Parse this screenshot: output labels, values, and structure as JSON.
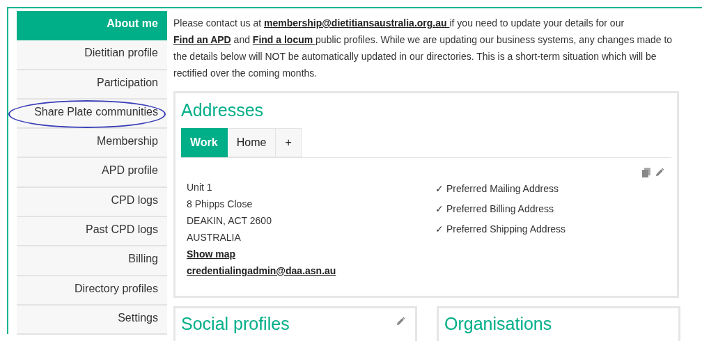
{
  "sidebar": {
    "items": [
      {
        "label": "About me",
        "selected": true,
        "circled": false
      },
      {
        "label": "Dietitian profile",
        "selected": false,
        "circled": false
      },
      {
        "label": "Participation",
        "selected": false,
        "circled": false
      },
      {
        "label": "Share Plate communities",
        "selected": false,
        "circled": true
      },
      {
        "label": "Membership",
        "selected": false,
        "circled": false
      },
      {
        "label": "APD profile",
        "selected": false,
        "circled": false
      },
      {
        "label": "CPD logs",
        "selected": false,
        "circled": false
      },
      {
        "label": "Past CPD logs",
        "selected": false,
        "circled": false
      },
      {
        "label": "Billing",
        "selected": false,
        "circled": false
      },
      {
        "label": "Directory profiles",
        "selected": false,
        "circled": false
      },
      {
        "label": "Settings",
        "selected": false,
        "circled": false
      }
    ]
  },
  "notice": [
    {
      "kind": "text",
      "text": "Please contact us at "
    },
    {
      "kind": "link",
      "text": "membership@dietitiansaustralia.org.au "
    },
    {
      "kind": "text",
      "text": "if you need to update your details for our "
    },
    {
      "kind": "link",
      "text": "Find an APD"
    },
    {
      "kind": "text",
      "text": " and "
    },
    {
      "kind": "link",
      "text": "Find a locum "
    },
    {
      "kind": "text",
      "text": "public profiles. While we are updating our business systems, any changes made to the details below will NOT be automatically updated in our directories. This is a short-term situation which will be rectified over the coming months."
    }
  ],
  "addresses": {
    "title": "Addresses",
    "tabs": [
      {
        "label": "Work",
        "selected": true
      },
      {
        "label": "Home",
        "selected": false
      },
      {
        "label": "+",
        "selected": false
      }
    ],
    "lines": [
      {
        "kind": "text",
        "text": "Unit 1"
      },
      {
        "kind": "text",
        "text": "8 Phipps Close"
      },
      {
        "kind": "text",
        "text": "DEAKIN, ACT 2600"
      },
      {
        "kind": "text",
        "text": "AUSTRALIA"
      },
      {
        "kind": "link",
        "text": "Show map"
      },
      {
        "kind": "link",
        "text": "credentialingadmin@daa.asn.au"
      }
    ],
    "preferences": [
      {
        "mark": "✓",
        "label": "Preferred Mailing Address"
      },
      {
        "mark": "✓",
        "label": "Preferred Billing Address"
      },
      {
        "mark": "✓",
        "label": "Preferred Shipping Address"
      }
    ]
  },
  "cards": [
    {
      "title": "Social profiles",
      "editable": true
    },
    {
      "title": "Organisations",
      "editable": false
    }
  ]
}
